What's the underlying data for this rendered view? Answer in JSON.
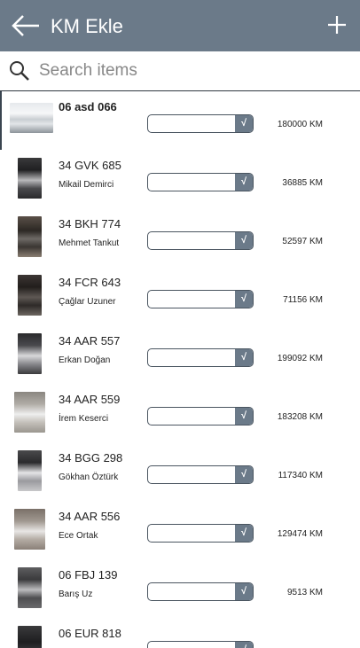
{
  "header": {
    "title": "KM Ekle"
  },
  "search": {
    "placeholder": "Search items"
  },
  "colors": {
    "header_bg": "#6b7a89",
    "check_bg": "#6b7a89"
  },
  "icons": {
    "back": "arrow-left-icon",
    "add": "plus-icon",
    "search": "search-icon",
    "confirm": "checkmark-icon"
  },
  "vehicles": [
    {
      "plate": "06 asd 066",
      "driver": "",
      "km": "180000 KM",
      "check": "√"
    },
    {
      "plate": "34 GVK 685",
      "driver": "Mikail Demirci",
      "km": "36885 KM",
      "check": "√"
    },
    {
      "plate": "34 BKH 774",
      "driver": "Mehmet Tankut",
      "km": "52597 KM",
      "check": "√"
    },
    {
      "plate": "34 FCR 643",
      "driver": "Çağlar Uzuner",
      "km": "71156 KM",
      "check": "√"
    },
    {
      "plate": "34 AAR 557",
      "driver": "Erkan Doğan",
      "km": "199092 KM",
      "check": "√"
    },
    {
      "plate": "34 AAR 559",
      "driver": "İrem Keserci",
      "km": "183208 KM",
      "check": "√"
    },
    {
      "plate": "34 BGG 298",
      "driver": "Gökhan Öztürk",
      "km": "117340 KM",
      "check": "√"
    },
    {
      "plate": "34 AAR 556",
      "driver": "Ece Ortak",
      "km": "129474 KM",
      "check": "√"
    },
    {
      "plate": "06 FBJ 139",
      "driver": "Barış Uz",
      "km": "9513 KM",
      "check": "√"
    },
    {
      "plate": "06 EUR 818",
      "driver": "",
      "km": "",
      "check": "√"
    }
  ]
}
